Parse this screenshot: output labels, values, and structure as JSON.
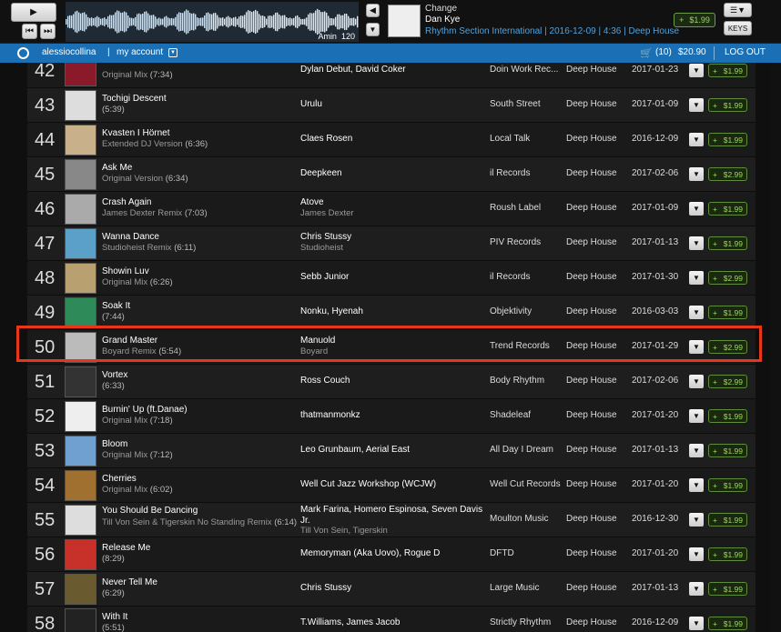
{
  "player": {
    "wave_key": "Amin",
    "wave_bpm": "120",
    "now_playing_title": "Change",
    "now_playing_artist": "Dan Kye",
    "now_playing_meta": "Rhythm Section International | 2016-12-09 | 4:36 | Deep House",
    "price": "$1.99",
    "keys_label": "KEYS"
  },
  "account": {
    "username": "alessiocollina",
    "separator": "|",
    "my_account": "my account",
    "cart_count": "(10)",
    "cart_total": "$20.90",
    "logout": "LOG OUT"
  },
  "tracks": [
    {
      "num": "42",
      "title": "",
      "mix": "Original Mix",
      "dur": "(7:34)",
      "artist": "Dylan Debut, David Coker",
      "remixer": "",
      "label": "Doin Work Rec...",
      "genre": "Deep House",
      "date": "2017-01-23",
      "price": "$1.99"
    },
    {
      "num": "43",
      "title": "Tochigi Descent",
      "mix": "",
      "dur": "(5:39)",
      "artist": "Urulu",
      "remixer": "",
      "label": "South Street",
      "genre": "Deep House",
      "date": "2017-01-09",
      "price": "$1.99"
    },
    {
      "num": "44",
      "title": "Kvasten I Hörnet",
      "mix": "Extended DJ Version",
      "dur": "(6:36)",
      "artist": "Claes Rosen",
      "remixer": "",
      "label": "Local Talk",
      "genre": "Deep House",
      "date": "2016-12-09",
      "price": "$1.99"
    },
    {
      "num": "45",
      "title": "Ask Me",
      "mix": "Original Version",
      "dur": "(6:34)",
      "artist": "Deepkeen",
      "remixer": "",
      "label": "il Records",
      "genre": "Deep House",
      "date": "2017-02-06",
      "price": "$2.99"
    },
    {
      "num": "46",
      "title": "Crash Again",
      "mix": "James Dexter Remix",
      "dur": "(7:03)",
      "artist": "Atove",
      "remixer": "James Dexter",
      "label": "Roush Label",
      "genre": "Deep House",
      "date": "2017-01-09",
      "price": "$1.99"
    },
    {
      "num": "47",
      "title": "Wanna Dance",
      "mix": "Studioheist Remix",
      "dur": "(6:11)",
      "artist": "Chris Stussy",
      "remixer": "Studioheist",
      "label": "PIV Records",
      "genre": "Deep House",
      "date": "2017-01-13",
      "price": "$1.99"
    },
    {
      "num": "48",
      "title": "Showin Luv",
      "mix": "Original Mix",
      "dur": "(6:26)",
      "artist": "Sebb Junior",
      "remixer": "",
      "label": "il Records",
      "genre": "Deep House",
      "date": "2017-01-30",
      "price": "$2.99"
    },
    {
      "num": "49",
      "title": "Soak It",
      "mix": "",
      "dur": "(7:44)",
      "artist": "Nonku, Hyenah",
      "remixer": "",
      "label": "Objektivity",
      "genre": "Deep House",
      "date": "2016-03-03",
      "price": "$1.99"
    },
    {
      "num": "50",
      "title": "Grand Master",
      "mix": "Boyard Remix",
      "dur": "(5:54)",
      "artist": "Manuold",
      "remixer": "Boyard",
      "label": "Trend Records",
      "genre": "Deep House",
      "date": "2017-01-29",
      "price": "$2.99"
    },
    {
      "num": "51",
      "title": "Vortex",
      "mix": "",
      "dur": "(6:33)",
      "artist": "Ross Couch",
      "remixer": "",
      "label": "Body Rhythm",
      "genre": "Deep House",
      "date": "2017-02-06",
      "price": "$2.99"
    },
    {
      "num": "52",
      "title": "Burnin' Up (ft.Danae)",
      "mix": "Original Mix",
      "dur": "(7:18)",
      "artist": "thatmanmonkz",
      "remixer": "",
      "label": "Shadeleaf",
      "genre": "Deep House",
      "date": "2017-01-20",
      "price": "$1.99"
    },
    {
      "num": "53",
      "title": "Bloom",
      "mix": "Original Mix",
      "dur": "(7:12)",
      "artist": "Leo Grunbaum, Aerial East",
      "remixer": "",
      "label": "All Day I Dream",
      "genre": "Deep House",
      "date": "2017-01-13",
      "price": "$1.99"
    },
    {
      "num": "54",
      "title": "Cherries",
      "mix": "Original Mix",
      "dur": "(6:02)",
      "artist": "Well Cut Jazz Workshop (WCJW)",
      "remixer": "",
      "label": "Well Cut Records",
      "genre": "Deep House",
      "date": "2017-01-20",
      "price": "$1.99"
    },
    {
      "num": "55",
      "title": "You Should Be Dancing",
      "mix": "Till Von Sein & Tigerskin No Standing Remix",
      "dur": "(6:14)",
      "artist": "Mark Farina, Homero Espinosa, Seven Davis Jr.",
      "remixer": "Till Von Sein, Tigerskin",
      "label": "Moulton Music",
      "genre": "Deep House",
      "date": "2016-12-30",
      "price": "$1.99"
    },
    {
      "num": "56",
      "title": "Release Me",
      "mix": "",
      "dur": "(8:29)",
      "artist": "Memoryman (Aka Uovo), Rogue D",
      "remixer": "",
      "label": "DFTD",
      "genre": "Deep House",
      "date": "2017-01-20",
      "price": "$1.99"
    },
    {
      "num": "57",
      "title": "Never Tell Me",
      "mix": "",
      "dur": "(6:29)",
      "artist": "Chris Stussy",
      "remixer": "",
      "label": "Large Music",
      "genre": "Deep House",
      "date": "2017-01-13",
      "price": "$1.99"
    },
    {
      "num": "58",
      "title": "With It",
      "mix": "",
      "dur": "(5:51)",
      "artist": "T.Williams, James Jacob",
      "remixer": "",
      "label": "Strictly Rhythm",
      "genre": "Deep House",
      "date": "2016-12-09",
      "price": "$1.99"
    }
  ],
  "art_colors": [
    "#8a1a2a",
    "#ddd",
    "#c8b08a",
    "#888",
    "#aaa",
    "#5aa0c8",
    "#b8a070",
    "#2f8a5a",
    "#bbb",
    "#333",
    "#eee",
    "#6fa0d0",
    "#a07030",
    "#ddd",
    "#c8302a",
    "#6a5a30",
    "#222"
  ],
  "colors": {
    "accent_blue": "#1b6fb4",
    "buy_green": "#9ed36a",
    "highlight": "#e8361a"
  }
}
